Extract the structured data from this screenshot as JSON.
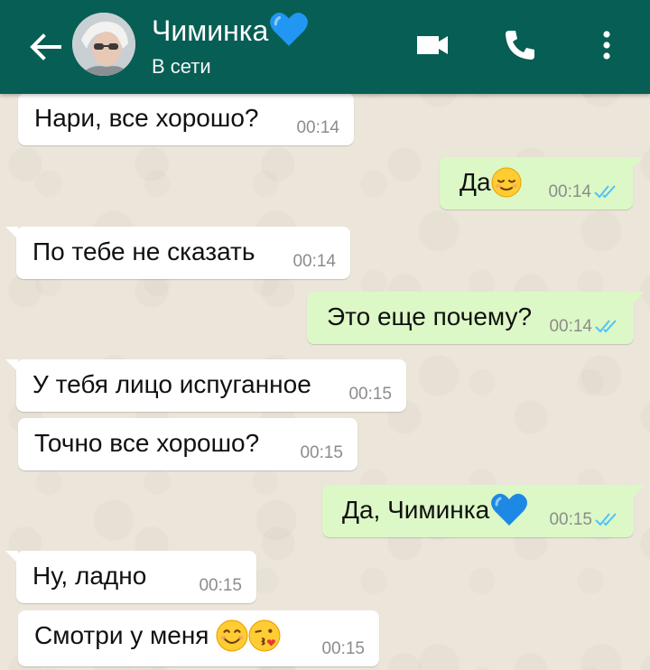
{
  "header": {
    "contact_name": "Чиминка",
    "status": "В сети",
    "accent_color": "#075E54",
    "icons": [
      "back-arrow-icon",
      "avatar",
      "video-call-icon",
      "phone-call-icon",
      "more-options-icon"
    ]
  },
  "messages": [
    {
      "direction": "incoming",
      "text": "Нари, все хорошо?",
      "time": "00:14"
    },
    {
      "direction": "outgoing",
      "text": "Да",
      "emoji": "relieved-face",
      "time": "00:14",
      "status": "read"
    },
    {
      "direction": "incoming",
      "text": "По тебе не сказать",
      "time": "00:14"
    },
    {
      "direction": "outgoing",
      "text": "Это еще почему?",
      "time": "00:14",
      "status": "read"
    },
    {
      "direction": "incoming",
      "text": "У тебя лицо испуганное",
      "time": "00:15"
    },
    {
      "direction": "incoming",
      "text": "Точно все хорошо?",
      "time": "00:15"
    },
    {
      "direction": "outgoing",
      "text": "Да, Чиминка",
      "emoji": "blue-heart",
      "time": "00:15",
      "status": "read"
    },
    {
      "direction": "incoming",
      "text": "Ну, ладно",
      "time": "00:15"
    },
    {
      "direction": "incoming",
      "text": "Смотри у меня",
      "emoji": "smiling-face, face-blowing-kiss",
      "time": "00:15"
    }
  ],
  "colors": {
    "incoming_bubble": "#FFFFFF",
    "outgoing_bubble": "#DCF8C6",
    "read_ticks": "#4FC3F7",
    "chat_background": "#ECE5DA"
  }
}
